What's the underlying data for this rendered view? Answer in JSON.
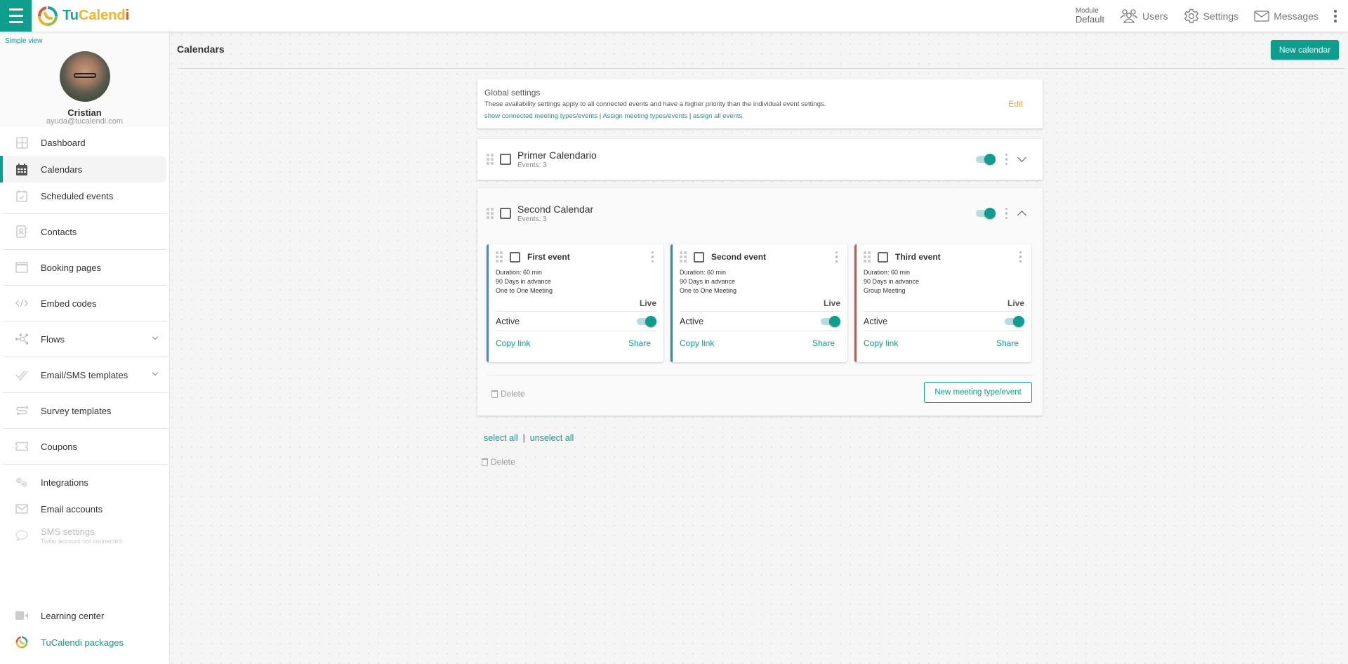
{
  "app": {
    "brand_tu": "Tu",
    "brand_calend": "Calend",
    "brand_i": "i",
    "colors": {
      "primary": "#0e9e8e",
      "edit": "#f5a623",
      "event1": "#2196f3",
      "event2": "#0e9e8e",
      "event3": "#f44336"
    }
  },
  "topbar": {
    "module_label": "Module",
    "module_value": "Default",
    "users": "Users",
    "settings": "Settings",
    "messages": "Messages"
  },
  "sidebar": {
    "simple_view": "Simple view",
    "user_name": "Cristian",
    "user_email": "ayuda@tucalendi.com",
    "items": [
      {
        "label": "Dashboard",
        "icon": "dashboard-icon"
      },
      {
        "label": "Calendars",
        "icon": "calendar-icon",
        "active": true
      },
      {
        "label": "Scheduled events",
        "icon": "scheduled-events-icon"
      },
      {
        "label": "Contacts",
        "icon": "contacts-icon"
      },
      {
        "label": "Booking pages",
        "icon": "booking-pages-icon"
      },
      {
        "label": "Embed codes",
        "icon": "code-icon"
      },
      {
        "label": "Flows",
        "icon": "flows-icon",
        "expandable": true
      },
      {
        "label": "Email/SMS templates",
        "icon": "templates-icon",
        "expandable": true
      },
      {
        "label": "Survey templates",
        "icon": "survey-icon"
      },
      {
        "label": "Coupons",
        "icon": "coupon-icon"
      },
      {
        "label": "Integrations",
        "icon": "integrations-icon"
      },
      {
        "label": "Email accounts",
        "icon": "email-icon"
      },
      {
        "label": "SMS settings",
        "sublabel": "Twilio account not connected",
        "icon": "sms-icon",
        "disabled": true
      },
      {
        "label": "Learning center",
        "icon": "video-icon"
      },
      {
        "label": "TuCalendi packages",
        "icon": "tucalendi-logo-icon"
      }
    ]
  },
  "main": {
    "title": "Calendars",
    "new_calendar": "New calendar",
    "global_settings": {
      "title": "Global settings",
      "description": "These availability settings apply to all connected events and have a higher priority than the individual event settings.",
      "link1": "show connected meeting types/events",
      "link2": "Assign meeting types/events",
      "link3": "assign all events",
      "separator": "|",
      "edit": "Edit"
    },
    "calendars": [
      {
        "name": "Primer Calendario",
        "events_text": "Events: 3",
        "enabled": true,
        "expanded": false
      },
      {
        "name": "Second Calendar",
        "events_text": "Events: 3",
        "enabled": true,
        "expanded": true,
        "events": [
          {
            "title": "First event",
            "duration": "Duration: 60 min",
            "advance": "90 Days in advance",
            "type": "One to One Meeting",
            "status": "Live",
            "active_label": "Active",
            "active": true,
            "copy": "Copy link",
            "share": "Share"
          },
          {
            "title": "Second event",
            "duration": "Duration: 60 min",
            "advance": "90 Days in advance",
            "type": "One to One Meeting",
            "status": "Live",
            "active_label": "Active",
            "active": true,
            "copy": "Copy link",
            "share": "Share"
          },
          {
            "title": "Third event",
            "duration": "Duration: 60 min",
            "advance": "90 Days in advance",
            "type": "Group Meeting",
            "status": "Live",
            "active_label": "Active",
            "active": true,
            "copy": "Copy link",
            "share": "Share"
          }
        ],
        "delete": "Delete",
        "new_event": "New meeting type/event"
      }
    ],
    "select_all": "select all",
    "separator": "|",
    "unselect_all": "unselect all",
    "delete": "Delete"
  }
}
